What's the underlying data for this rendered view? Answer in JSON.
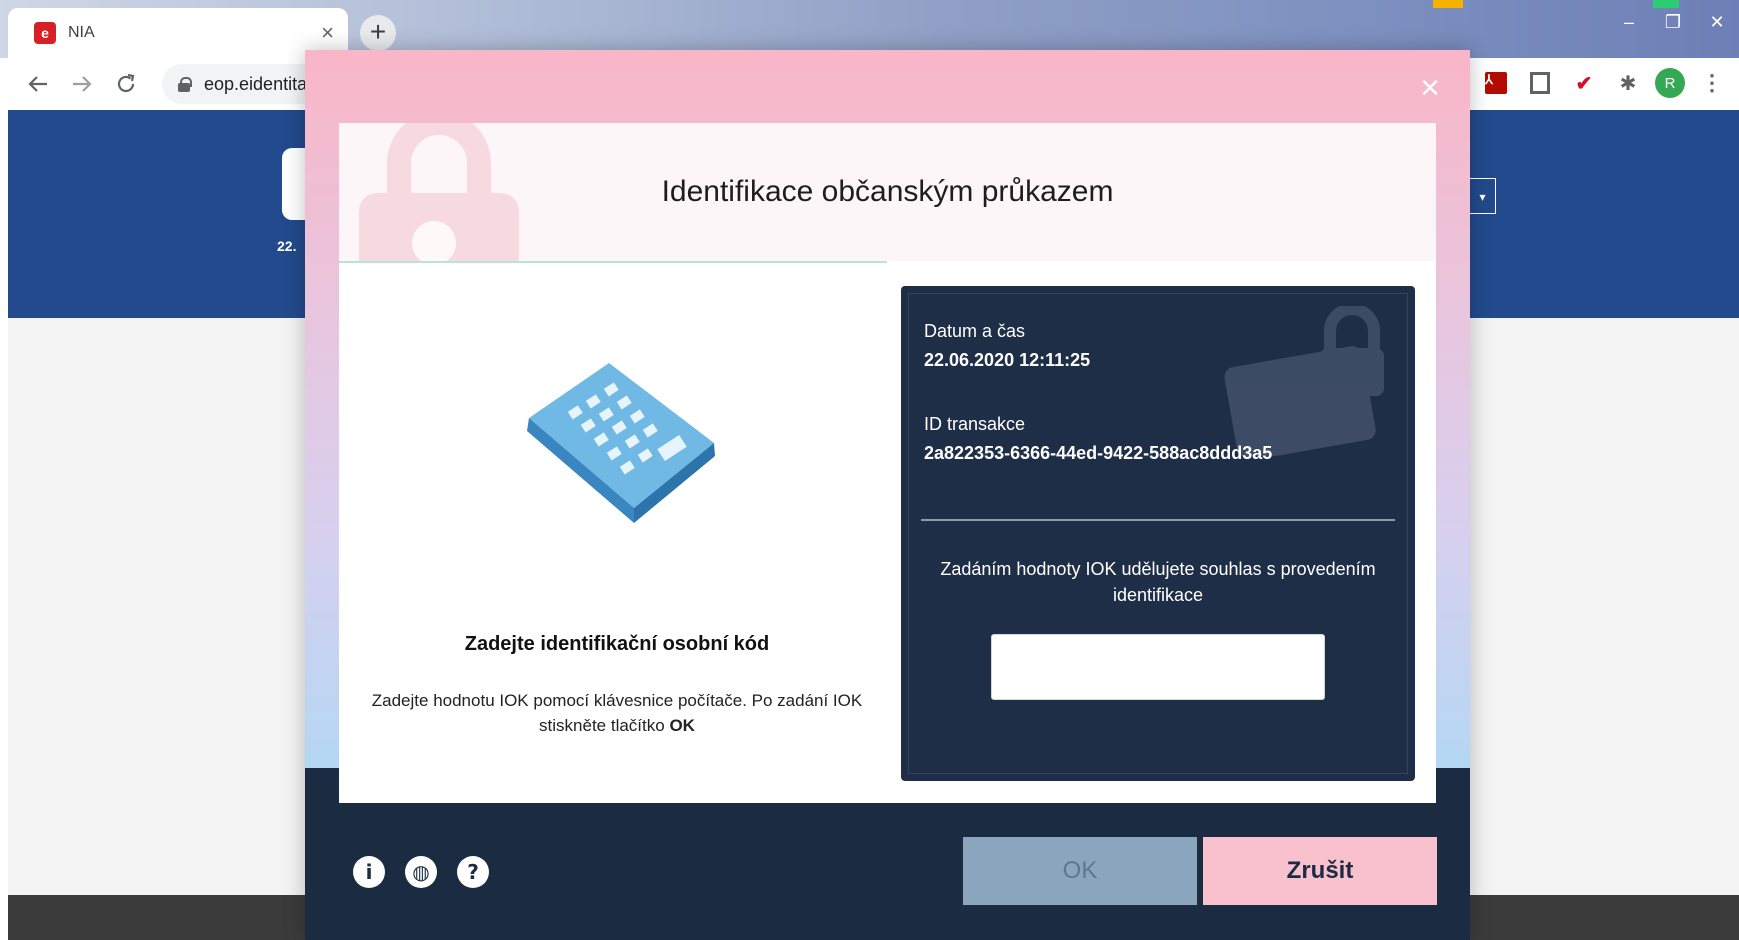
{
  "browser": {
    "tab_title": "NIA",
    "tab_close": "×",
    "new_tab": "+",
    "url": "eop.eidentita.cz",
    "back_icon": "arrow-left-icon",
    "forward_icon": "arrow-right-icon",
    "reload_icon": "reload-icon",
    "avatar_letter": "R",
    "window_controls": [
      "–",
      "❐",
      "✕"
    ]
  },
  "page": {
    "header_date": "22.",
    "header_color": "#224a8c"
  },
  "modal": {
    "title": "Identifikace občanským průkazem",
    "close_label": "×",
    "instruction_title": "Zadejte identifikační osobní kód",
    "instruction_text_prefix": "Zadejte hodnotu IOK pomocí klávesnice počítače. Po zadání IOK stiskněte tlačítko ",
    "instruction_text_bold": "OK",
    "info": {
      "datetime_label": "Datum a čas",
      "datetime_value": "22.06.2020 12:11:25",
      "transaction_label": "ID transakce",
      "transaction_value": "2a822353-6366-44ed-9422-588ac8ddd3a5",
      "consent_text": "Zadáním hodnoty IOK udělujete souhlas s provedením identifikace",
      "iok_value": ""
    },
    "buttons": {
      "ok": "OK",
      "cancel": "Zrušit"
    },
    "footer_icons": [
      "info-icon",
      "globe-icon",
      "help-icon"
    ]
  }
}
